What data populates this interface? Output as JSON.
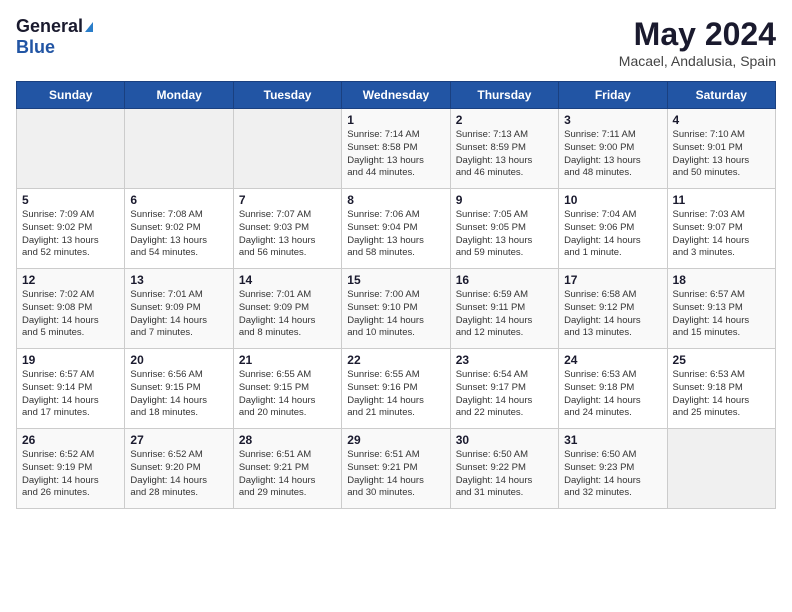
{
  "header": {
    "logo_general": "General",
    "logo_blue": "Blue",
    "title": "May 2024",
    "location": "Macael, Andalusia, Spain"
  },
  "days_of_week": [
    "Sunday",
    "Monday",
    "Tuesday",
    "Wednesday",
    "Thursday",
    "Friday",
    "Saturday"
  ],
  "weeks": [
    [
      {
        "day": "",
        "empty": true
      },
      {
        "day": "",
        "empty": true
      },
      {
        "day": "",
        "empty": true
      },
      {
        "day": "1",
        "lines": [
          "Sunrise: 7:14 AM",
          "Sunset: 8:58 PM",
          "Daylight: 13 hours",
          "and 44 minutes."
        ]
      },
      {
        "day": "2",
        "lines": [
          "Sunrise: 7:13 AM",
          "Sunset: 8:59 PM",
          "Daylight: 13 hours",
          "and 46 minutes."
        ]
      },
      {
        "day": "3",
        "lines": [
          "Sunrise: 7:11 AM",
          "Sunset: 9:00 PM",
          "Daylight: 13 hours",
          "and 48 minutes."
        ]
      },
      {
        "day": "4",
        "lines": [
          "Sunrise: 7:10 AM",
          "Sunset: 9:01 PM",
          "Daylight: 13 hours",
          "and 50 minutes."
        ]
      }
    ],
    [
      {
        "day": "5",
        "lines": [
          "Sunrise: 7:09 AM",
          "Sunset: 9:02 PM",
          "Daylight: 13 hours",
          "and 52 minutes."
        ]
      },
      {
        "day": "6",
        "lines": [
          "Sunrise: 7:08 AM",
          "Sunset: 9:02 PM",
          "Daylight: 13 hours",
          "and 54 minutes."
        ]
      },
      {
        "day": "7",
        "lines": [
          "Sunrise: 7:07 AM",
          "Sunset: 9:03 PM",
          "Daylight: 13 hours",
          "and 56 minutes."
        ]
      },
      {
        "day": "8",
        "lines": [
          "Sunrise: 7:06 AM",
          "Sunset: 9:04 PM",
          "Daylight: 13 hours",
          "and 58 minutes."
        ]
      },
      {
        "day": "9",
        "lines": [
          "Sunrise: 7:05 AM",
          "Sunset: 9:05 PM",
          "Daylight: 13 hours",
          "and 59 minutes."
        ]
      },
      {
        "day": "10",
        "lines": [
          "Sunrise: 7:04 AM",
          "Sunset: 9:06 PM",
          "Daylight: 14 hours",
          "and 1 minute."
        ]
      },
      {
        "day": "11",
        "lines": [
          "Sunrise: 7:03 AM",
          "Sunset: 9:07 PM",
          "Daylight: 14 hours",
          "and 3 minutes."
        ]
      }
    ],
    [
      {
        "day": "12",
        "lines": [
          "Sunrise: 7:02 AM",
          "Sunset: 9:08 PM",
          "Daylight: 14 hours",
          "and 5 minutes."
        ]
      },
      {
        "day": "13",
        "lines": [
          "Sunrise: 7:01 AM",
          "Sunset: 9:09 PM",
          "Daylight: 14 hours",
          "and 7 minutes."
        ]
      },
      {
        "day": "14",
        "lines": [
          "Sunrise: 7:01 AM",
          "Sunset: 9:09 PM",
          "Daylight: 14 hours",
          "and 8 minutes."
        ]
      },
      {
        "day": "15",
        "lines": [
          "Sunrise: 7:00 AM",
          "Sunset: 9:10 PM",
          "Daylight: 14 hours",
          "and 10 minutes."
        ]
      },
      {
        "day": "16",
        "lines": [
          "Sunrise: 6:59 AM",
          "Sunset: 9:11 PM",
          "Daylight: 14 hours",
          "and 12 minutes."
        ]
      },
      {
        "day": "17",
        "lines": [
          "Sunrise: 6:58 AM",
          "Sunset: 9:12 PM",
          "Daylight: 14 hours",
          "and 13 minutes."
        ]
      },
      {
        "day": "18",
        "lines": [
          "Sunrise: 6:57 AM",
          "Sunset: 9:13 PM",
          "Daylight: 14 hours",
          "and 15 minutes."
        ]
      }
    ],
    [
      {
        "day": "19",
        "lines": [
          "Sunrise: 6:57 AM",
          "Sunset: 9:14 PM",
          "Daylight: 14 hours",
          "and 17 minutes."
        ]
      },
      {
        "day": "20",
        "lines": [
          "Sunrise: 6:56 AM",
          "Sunset: 9:15 PM",
          "Daylight: 14 hours",
          "and 18 minutes."
        ]
      },
      {
        "day": "21",
        "lines": [
          "Sunrise: 6:55 AM",
          "Sunset: 9:15 PM",
          "Daylight: 14 hours",
          "and 20 minutes."
        ]
      },
      {
        "day": "22",
        "lines": [
          "Sunrise: 6:55 AM",
          "Sunset: 9:16 PM",
          "Daylight: 14 hours",
          "and 21 minutes."
        ]
      },
      {
        "day": "23",
        "lines": [
          "Sunrise: 6:54 AM",
          "Sunset: 9:17 PM",
          "Daylight: 14 hours",
          "and 22 minutes."
        ]
      },
      {
        "day": "24",
        "lines": [
          "Sunrise: 6:53 AM",
          "Sunset: 9:18 PM",
          "Daylight: 14 hours",
          "and 24 minutes."
        ]
      },
      {
        "day": "25",
        "lines": [
          "Sunrise: 6:53 AM",
          "Sunset: 9:18 PM",
          "Daylight: 14 hours",
          "and 25 minutes."
        ]
      }
    ],
    [
      {
        "day": "26",
        "lines": [
          "Sunrise: 6:52 AM",
          "Sunset: 9:19 PM",
          "Daylight: 14 hours",
          "and 26 minutes."
        ]
      },
      {
        "day": "27",
        "lines": [
          "Sunrise: 6:52 AM",
          "Sunset: 9:20 PM",
          "Daylight: 14 hours",
          "and 28 minutes."
        ]
      },
      {
        "day": "28",
        "lines": [
          "Sunrise: 6:51 AM",
          "Sunset: 9:21 PM",
          "Daylight: 14 hours",
          "and 29 minutes."
        ]
      },
      {
        "day": "29",
        "lines": [
          "Sunrise: 6:51 AM",
          "Sunset: 9:21 PM",
          "Daylight: 14 hours",
          "and 30 minutes."
        ]
      },
      {
        "day": "30",
        "lines": [
          "Sunrise: 6:50 AM",
          "Sunset: 9:22 PM",
          "Daylight: 14 hours",
          "and 31 minutes."
        ]
      },
      {
        "day": "31",
        "lines": [
          "Sunrise: 6:50 AM",
          "Sunset: 9:23 PM",
          "Daylight: 14 hours",
          "and 32 minutes."
        ]
      },
      {
        "day": "",
        "empty": true
      }
    ]
  ]
}
